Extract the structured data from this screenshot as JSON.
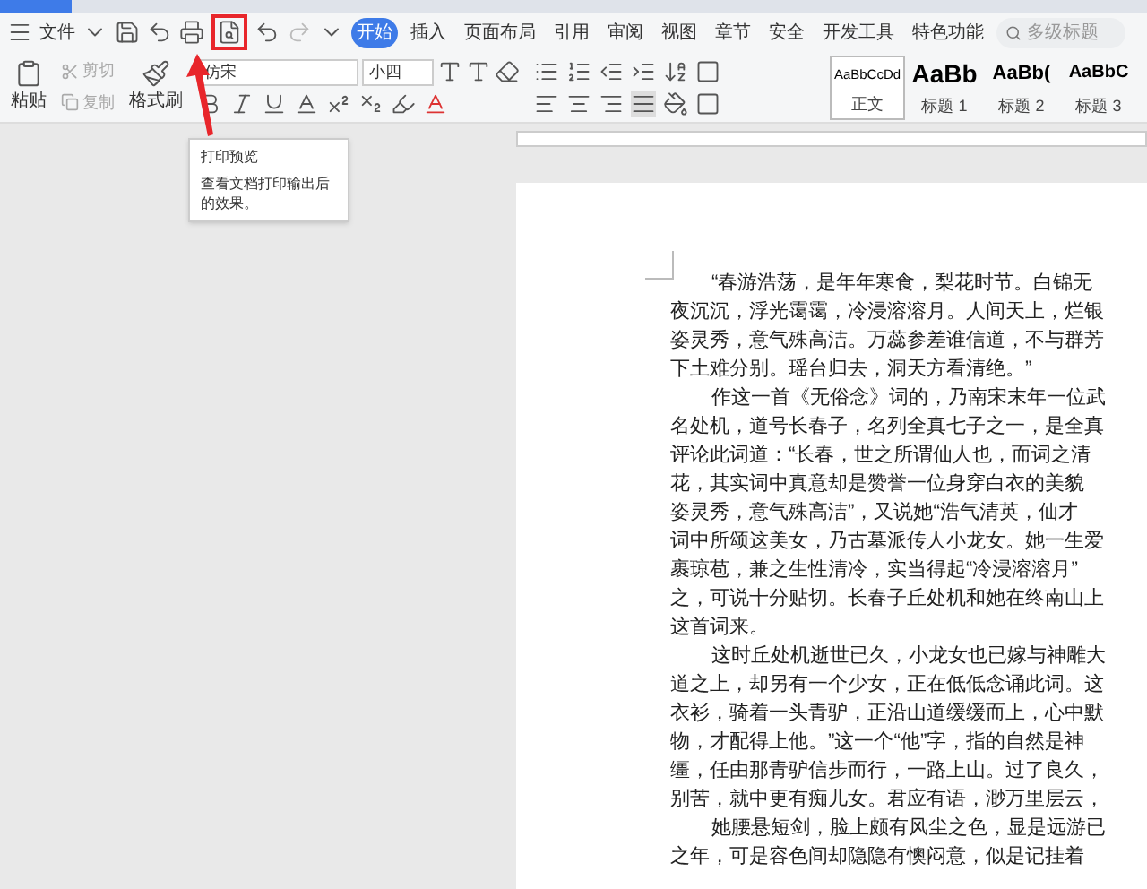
{
  "menu": {
    "file_label": "文件",
    "tabs": [
      {
        "label": "开始",
        "selected": true
      },
      {
        "label": "插入",
        "selected": false
      },
      {
        "label": "页面布局",
        "selected": false
      },
      {
        "label": "引用",
        "selected": false
      },
      {
        "label": "审阅",
        "selected": false
      },
      {
        "label": "视图",
        "selected": false
      },
      {
        "label": "章节",
        "selected": false
      },
      {
        "label": "安全",
        "selected": false
      },
      {
        "label": "开发工具",
        "selected": false
      },
      {
        "label": "特色功能",
        "selected": false
      }
    ],
    "search": {
      "placeholder": "多级标题"
    }
  },
  "ribbon": {
    "clipboard": [
      {
        "label": "剪切",
        "disabled": true
      },
      {
        "label": "复制",
        "disabled": true
      }
    ],
    "paste": "粘贴",
    "format_painter": "格式刷",
    "font": {
      "name": "仿宋",
      "size": "小四"
    },
    "styles": [
      {
        "preview": "AaBbCcDd",
        "label": "正文",
        "selected": true
      },
      {
        "preview": "AaBb",
        "label": "标题 1",
        "selected": false
      },
      {
        "preview": "AaBb(",
        "label": "标题 2",
        "selected": false
      },
      {
        "preview": "AaBbC",
        "label": "标题 3",
        "selected": false
      }
    ]
  },
  "tooltip": {
    "title": "打印预览",
    "text": "查看文档打印输出后的效果。"
  },
  "document": {
    "lines": [
      {
        "text": "“春游浩荡，是年年寒食，梨花时节。白锦无",
        "first_line": true
      },
      {
        "text": "夜沉沉，浮光霭霭，冷浸溶溶月。人间天上，烂银",
        "first_line": false
      },
      {
        "text": "姿灵秀，意气殊高洁。万蕊参差谁信道，不与群芳",
        "first_line": false
      },
      {
        "text": "下土难分别。瑶台归去，洞天方看清绝。”",
        "first_line": false
      },
      {
        "text": "作这一首《无俗念》词的，乃南宋末年一位武",
        "first_line": true
      },
      {
        "text": "名处机，道号长春子，名列全真七子之一，是全真",
        "first_line": false
      },
      {
        "text": "评论此词道：“长春，世之所谓仙人也，而词之清",
        "first_line": false
      },
      {
        "text": "花，其实词中真意却是赞誉一位身穿白衣的美貌",
        "first_line": false
      },
      {
        "text": "姿灵秀，意气殊高洁”，又说她“浩气清英，仙才",
        "first_line": false
      },
      {
        "text": "词中所颂这美女，乃古墓派传人小龙女。她一生爱",
        "first_line": false
      },
      {
        "text": "裹琼苞，兼之生性清冷，实当得起“冷浸溶溶月”",
        "first_line": false
      },
      {
        "text": "之，可说十分贴切。长春子丘处机和她在终南山上",
        "first_line": false
      },
      {
        "text": "这首词来。",
        "first_line": false
      },
      {
        "text": "这时丘处机逝世已久，小龙女也已嫁与神雕大",
        "first_line": true
      },
      {
        "text": "道之上，却另有一个少女，正在低低念诵此词。这",
        "first_line": false
      },
      {
        "text": "衣衫，骑着一头青驴，正沿山道缓缓而上，心中默",
        "first_line": false
      },
      {
        "text": "物，才配得上他。”这一个“他”字，指的自然是神",
        "first_line": false
      },
      {
        "text": "缰，任由那青驴信步而行，一路上山。过了良久，",
        "first_line": false
      },
      {
        "text": "别苦，就中更有痴儿女。君应有语，渺万里层云，",
        "first_line": false
      },
      {
        "text": "她腰悬短剑，脸上颇有风尘之色，显是远游已",
        "first_line": true
      },
      {
        "text": "之年，可是容色间却隐隐有懊闷意，似是记挂着",
        "first_line": false
      }
    ]
  }
}
